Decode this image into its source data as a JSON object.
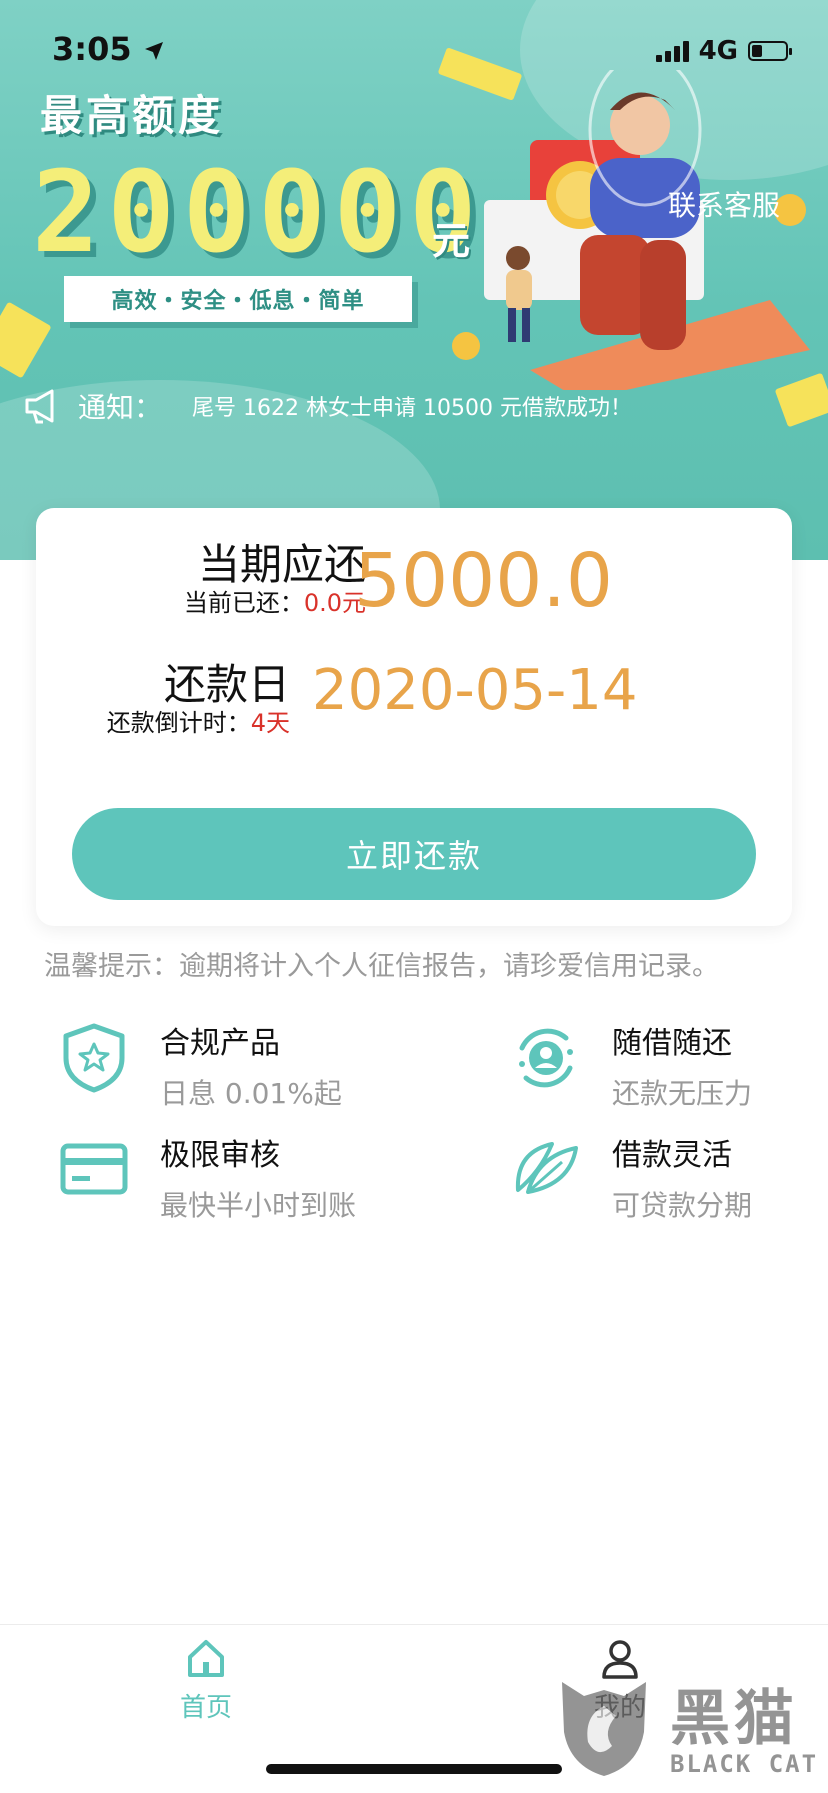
{
  "status_bar": {
    "time": "3:05",
    "network": "4G"
  },
  "banner": {
    "headline": "最高额度",
    "max_amount": "200000",
    "unit": "元",
    "tags": "高效・安全・低息・简单",
    "contact_label": "联系客服"
  },
  "notice": {
    "label": "通知：",
    "text": "尾号 1622 林女士申请 10500 元借款成功！"
  },
  "repayment": {
    "due_title": "当期应还",
    "paid_label": "当前已还：",
    "paid_value": "0.0元",
    "due_amount": "5000.0",
    "date_title": "还款日",
    "countdown_label": "还款倒计时：",
    "countdown_value": "4天",
    "due_date": "2020-05-14",
    "pay_button": "立即还款"
  },
  "tip": "温馨提示：逾期将计入个人征信报告，请珍爱信用记录。",
  "features": [
    {
      "title": "合规产品",
      "subtitle": "日息 0.01%起",
      "icon": "shield-star-icon"
    },
    {
      "title": "随借随还",
      "subtitle": "还款无压力",
      "icon": "user-cycle-icon"
    },
    {
      "title": "极限审核",
      "subtitle": "最快半小时到账",
      "icon": "card-icon"
    },
    {
      "title": "借款灵活",
      "subtitle": "可贷款分期",
      "icon": "leaf-icon"
    }
  ],
  "tabbar": {
    "home": "首页",
    "mine": "我的"
  },
  "watermark": {
    "cn": "黑猫",
    "en": "BLACK CAT"
  },
  "colors": {
    "accent": "#5ec5bb",
    "amount": "#e8a44a",
    "alert": "#d9322a",
    "banner_amount": "#f4ee79"
  }
}
